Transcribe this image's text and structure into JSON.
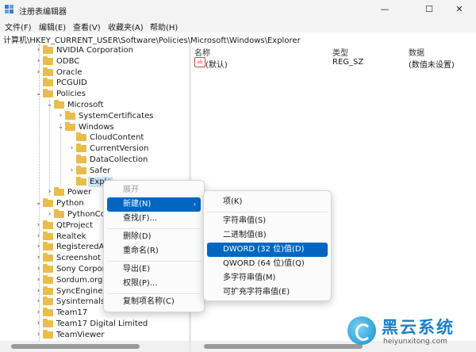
{
  "window": {
    "title": "注册表编辑器",
    "minimize": "—",
    "maximize": "☐",
    "close": "✕"
  },
  "menubar": [
    "文件(F)",
    "编辑(E)",
    "查看(V)",
    "收藏夹(A)",
    "帮助(H)"
  ],
  "address": "计算机\\HKEY_CURRENT_USER\\Software\\Policies\\Microsoft\\Windows\\Explorer",
  "tree": [
    {
      "label": "NVIDIA Corporation",
      "exp": "›"
    },
    {
      "label": "ODBC",
      "exp": "›"
    },
    {
      "label": "Oracle",
      "exp": "›"
    },
    {
      "label": "PCGUID",
      "exp": ""
    },
    {
      "label": "Policies",
      "exp": "⌄"
    },
    {
      "label": "Microsoft",
      "exp": "⌄"
    },
    {
      "label": "SystemCertificates",
      "exp": "›"
    },
    {
      "label": "Windows",
      "exp": "⌄"
    },
    {
      "label": "CloudContent",
      "exp": ""
    },
    {
      "label": "CurrentVersion",
      "exp": "›"
    },
    {
      "label": "DataCollection",
      "exp": ""
    },
    {
      "label": "Safer",
      "exp": "›"
    },
    {
      "label": "Explo",
      "exp": "",
      "selected": true
    },
    {
      "label": "Power",
      "exp": "›"
    },
    {
      "label": "Python",
      "exp": "⌄"
    },
    {
      "label": "PythonCo",
      "exp": "›"
    },
    {
      "label": "QtProject",
      "exp": "›"
    },
    {
      "label": "Realtek",
      "exp": "›"
    },
    {
      "label": "RegisteredAp",
      "exp": "›"
    },
    {
      "label": "Screenshot S",
      "exp": "›"
    },
    {
      "label": "Sony Corpor",
      "exp": "›"
    },
    {
      "label": "Sordum.org",
      "exp": "›"
    },
    {
      "label": "SyncEngines",
      "exp": "›"
    },
    {
      "label": "Sysinternals",
      "exp": "›"
    },
    {
      "label": "Team17",
      "exp": "›"
    },
    {
      "label": "Team17 Digital Limited",
      "exp": "›"
    },
    {
      "label": "TeamViewer",
      "exp": "›"
    }
  ],
  "list": {
    "headers": {
      "name": "名称",
      "type": "类型",
      "data": "数据"
    },
    "rows": [
      {
        "icon": "ab",
        "name": "(默认)",
        "type": "REG_SZ",
        "data": "(数值未设置)"
      }
    ]
  },
  "context_menu": [
    {
      "label": "展开",
      "disabled": true
    },
    {
      "label": "新建(N)",
      "highlight": true,
      "submenu": true
    },
    {
      "label": "查找(F)..."
    },
    {
      "sep": true
    },
    {
      "label": "删除(D)"
    },
    {
      "label": "重命名(R)"
    },
    {
      "sep": true
    },
    {
      "label": "导出(E)"
    },
    {
      "label": "权限(P)..."
    },
    {
      "sep": true
    },
    {
      "label": "复制项名称(C)"
    }
  ],
  "submenu": [
    {
      "label": "项(K)"
    },
    {
      "sep": true
    },
    {
      "label": "字符串值(S)"
    },
    {
      "label": "二进制值(B)"
    },
    {
      "label": "DWORD (32 位)值(D)",
      "highlight": true
    },
    {
      "label": "QWORD (64 位)值(Q)"
    },
    {
      "label": "多字符串值(M)"
    },
    {
      "label": "可扩充字符串值(E)"
    }
  ],
  "watermark": {
    "brand": "黑云系统",
    "url": "heiyunxitong.com"
  },
  "colors": {
    "highlight": "#0067c0",
    "folder": "#e9bd4b",
    "selection": "#cce4f7"
  }
}
